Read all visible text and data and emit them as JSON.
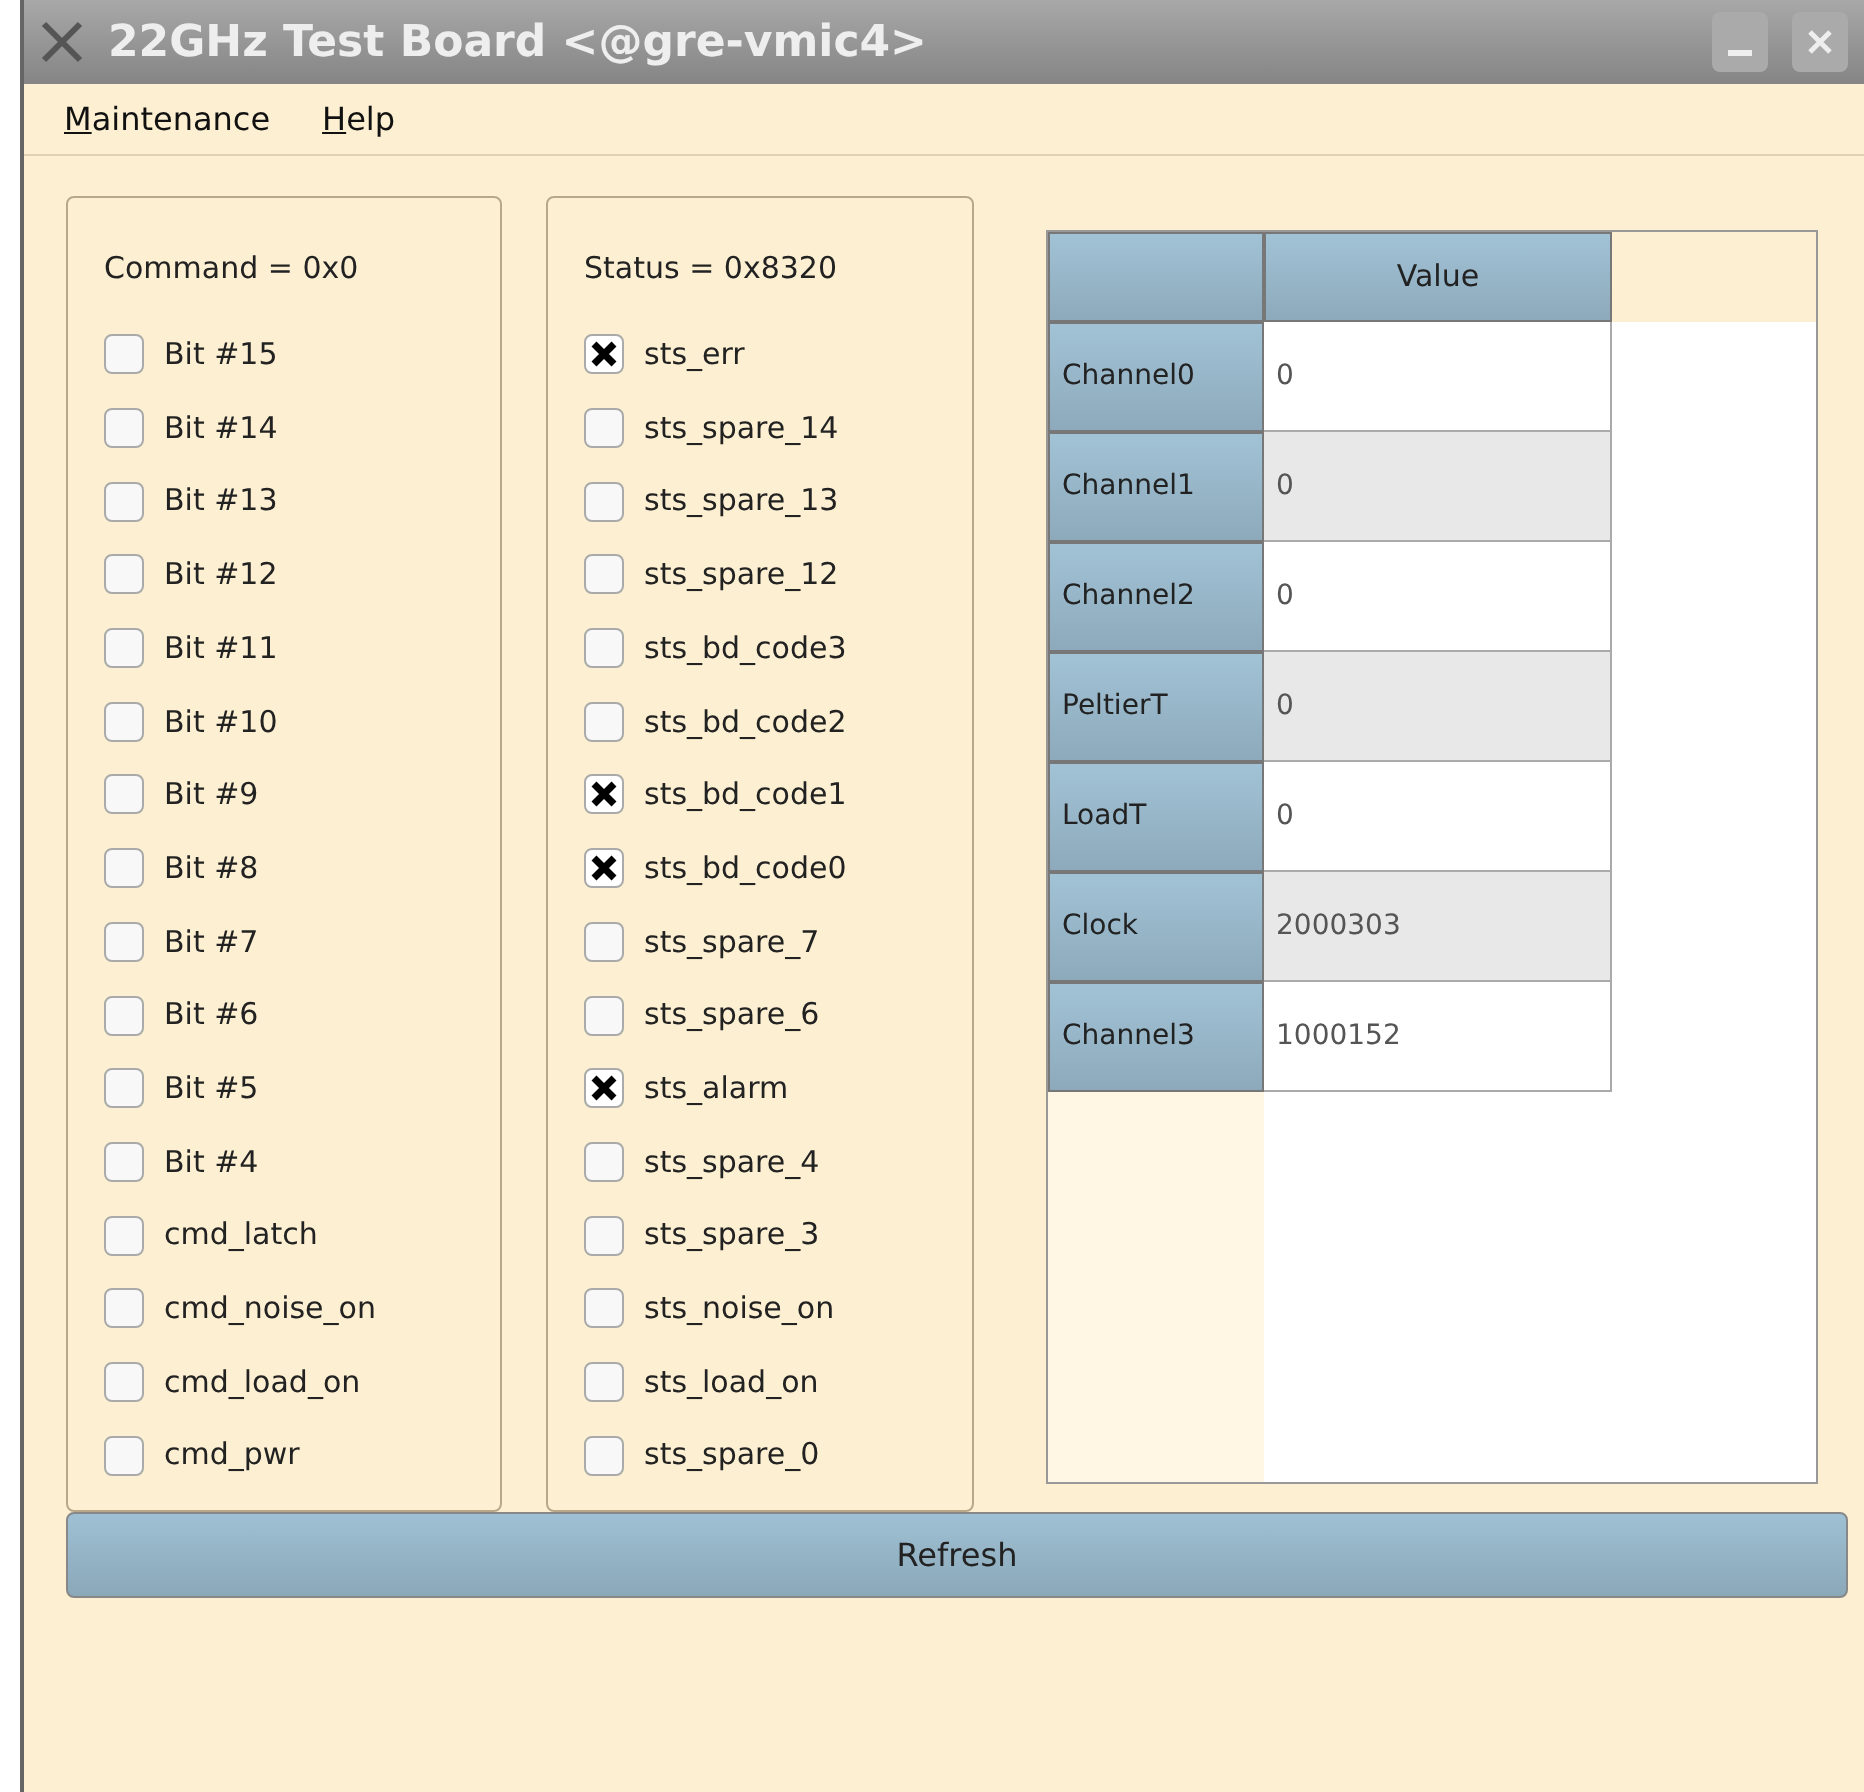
{
  "window": {
    "title": "22GHz Test Board <@gre-vmic4>"
  },
  "menu": [
    "Maintenance",
    "Help"
  ],
  "command_panel": {
    "title": "Command = 0x0",
    "bits": [
      {
        "label": "Bit #15",
        "checked": false
      },
      {
        "label": "Bit #14",
        "checked": false
      },
      {
        "label": "Bit #13",
        "checked": false
      },
      {
        "label": "Bit #12",
        "checked": false
      },
      {
        "label": "Bit #11",
        "checked": false
      },
      {
        "label": "Bit #10",
        "checked": false
      },
      {
        "label": "Bit #9",
        "checked": false
      },
      {
        "label": "Bit #8",
        "checked": false
      },
      {
        "label": "Bit #7",
        "checked": false
      },
      {
        "label": "Bit #6",
        "checked": false
      },
      {
        "label": "Bit #5",
        "checked": false
      },
      {
        "label": "Bit #4",
        "checked": false
      },
      {
        "label": "cmd_latch",
        "checked": false
      },
      {
        "label": "cmd_noise_on",
        "checked": false
      },
      {
        "label": "cmd_load_on",
        "checked": false
      },
      {
        "label": "cmd_pwr",
        "checked": false
      }
    ]
  },
  "status_panel": {
    "title": "Status = 0x8320",
    "bits": [
      {
        "label": "sts_err",
        "checked": true
      },
      {
        "label": "sts_spare_14",
        "checked": false
      },
      {
        "label": "sts_spare_13",
        "checked": false
      },
      {
        "label": "sts_spare_12",
        "checked": false
      },
      {
        "label": "sts_bd_code3",
        "checked": false
      },
      {
        "label": "sts_bd_code2",
        "checked": false
      },
      {
        "label": "sts_bd_code1",
        "checked": true
      },
      {
        "label": "sts_bd_code0",
        "checked": true
      },
      {
        "label": "sts_spare_7",
        "checked": false
      },
      {
        "label": "sts_spare_6",
        "checked": false
      },
      {
        "label": "sts_alarm",
        "checked": true
      },
      {
        "label": "sts_spare_4",
        "checked": false
      },
      {
        "label": "sts_spare_3",
        "checked": false
      },
      {
        "label": "sts_noise_on",
        "checked": false
      },
      {
        "label": "sts_load_on",
        "checked": false
      },
      {
        "label": "sts_spare_0",
        "checked": false
      }
    ]
  },
  "table": {
    "columns": [
      "Value"
    ],
    "rows": [
      {
        "header": "Channel0",
        "value": "0"
      },
      {
        "header": "Channel1",
        "value": "0"
      },
      {
        "header": "Channel2",
        "value": "0"
      },
      {
        "header": "PeltierT",
        "value": "0"
      },
      {
        "header": "LoadT",
        "value": "0"
      },
      {
        "header": "Clock",
        "value": "2000303"
      },
      {
        "header": "Channel3",
        "value": "1000152"
      }
    ]
  },
  "buttons": [
    "Refresh"
  ]
}
